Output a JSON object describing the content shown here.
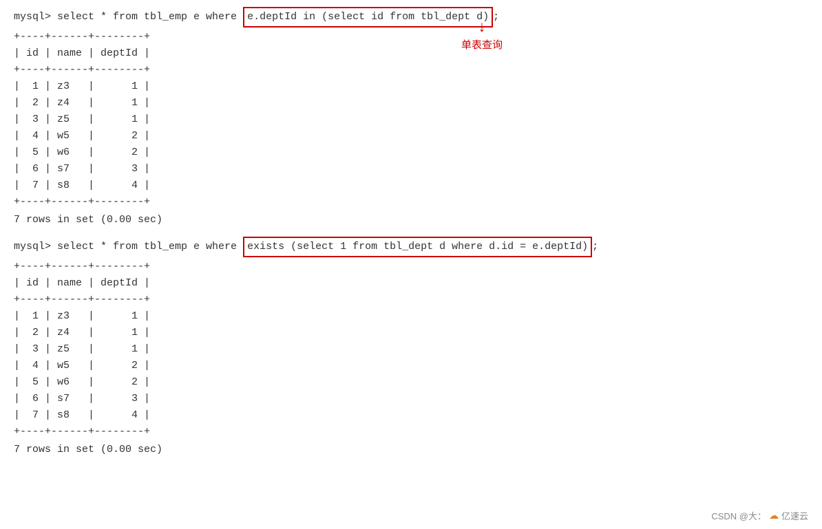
{
  "query1": {
    "prompt": "mysql> ",
    "before_highlight": "select * from tbl_emp e where ",
    "highlight": "e.deptId in (select id from tbl_dept d)",
    "after": ";"
  },
  "query2": {
    "prompt": "mysql> ",
    "before_highlight": "select * from tbl_emp e where ",
    "highlight": "exists (select 1 from tbl_dept d where d.id = e.deptId)",
    "after": ";"
  },
  "table1": {
    "separator_top": "+----+------+--------+",
    "header": "| id | name | deptId |",
    "separator_mid": "+----+------+--------+",
    "rows": [
      "|  1 | z3   |      1 |",
      "|  2 | z4   |      1 |",
      "|  3 | z5   |      1 |",
      "|  4 | w5   |      2 |",
      "|  5 | w6   |      2 |",
      "|  6 | s7   |      3 |",
      "|  7 | s8   |      4 |"
    ],
    "separator_bottom": "+----+------+--------+",
    "rows_info": "7 rows in set (0.00 sec)"
  },
  "table2": {
    "separator_top": "+----+------+--------+",
    "header": "| id | name | deptId |",
    "separator_mid": "+----+------+--------+",
    "rows": [
      "|  1 | z3   |      1 |",
      "|  2 | z4   |      1 |",
      "|  3 | z5   |      1 |",
      "|  4 | w5   |      2 |",
      "|  5 | w6   |      2 |",
      "|  6 | s7   |      3 |",
      "|  7 | s8   |      4 |"
    ],
    "separator_bottom": "+----+------+--------+",
    "rows_info": "7 rows in set (0.00 sec)"
  },
  "annotation": {
    "label": "单表查询"
  },
  "footer": {
    "text": "CSDN @大：",
    "icon": "☁",
    "brand": "亿速云"
  }
}
